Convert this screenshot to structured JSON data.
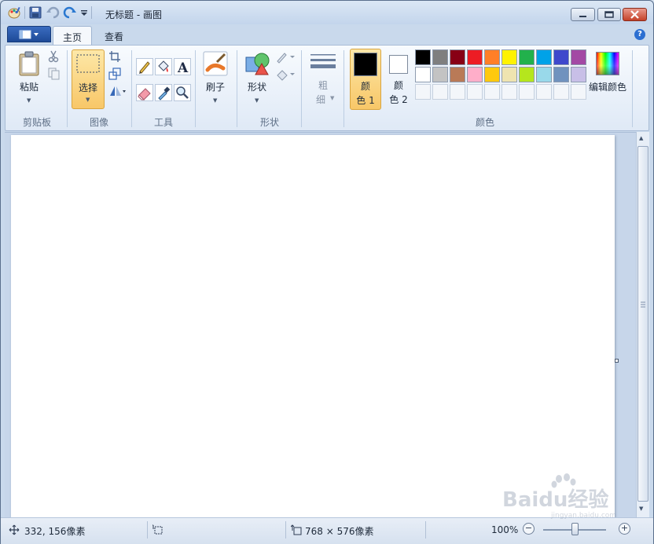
{
  "titlebar": {
    "title": "无标题 - 画图"
  },
  "tabs": {
    "home": "主页",
    "view": "查看"
  },
  "ribbon": {
    "clipboard": {
      "paste": "粘贴",
      "group": "剪贴板"
    },
    "image": {
      "select": "选择",
      "group": "图像"
    },
    "tools": {
      "group": "工具"
    },
    "brushes": {
      "label": "刷子"
    },
    "shapes": {
      "label": "形状",
      "group": "形状"
    },
    "size": {
      "line1": "粗",
      "line2": "细"
    },
    "colors": {
      "color1_line1": "颜",
      "color1_line2": "色 1",
      "color2_line1": "颜",
      "color2_line2": "色 2",
      "edit": "编辑颜色",
      "group": "颜色",
      "color1_value": "#000000",
      "color2_value": "#ffffff",
      "palette_row1": [
        "#000000",
        "#7f7f7f",
        "#880015",
        "#ed1c24",
        "#ff7f27",
        "#fff200",
        "#22b14c",
        "#00a2e8",
        "#3f48cc",
        "#a349a4"
      ],
      "palette_row2": [
        "#ffffff",
        "#c3c3c3",
        "#b97a57",
        "#ffaec9",
        "#ffc90e",
        "#efe4b0",
        "#b5e61d",
        "#99d9ea",
        "#7092be",
        "#c8bfe7"
      ],
      "palette_row3": [
        "",
        "",
        "",
        "",
        "",
        "",
        "",
        "",
        "",
        ""
      ]
    }
  },
  "status": {
    "cursor": "332, 156像素",
    "selection": "",
    "canvas_size": "768 × 576像素",
    "zoom": "100%"
  },
  "watermark": {
    "text": "Baidu经验",
    "url": "jingyan.baidu.com"
  }
}
